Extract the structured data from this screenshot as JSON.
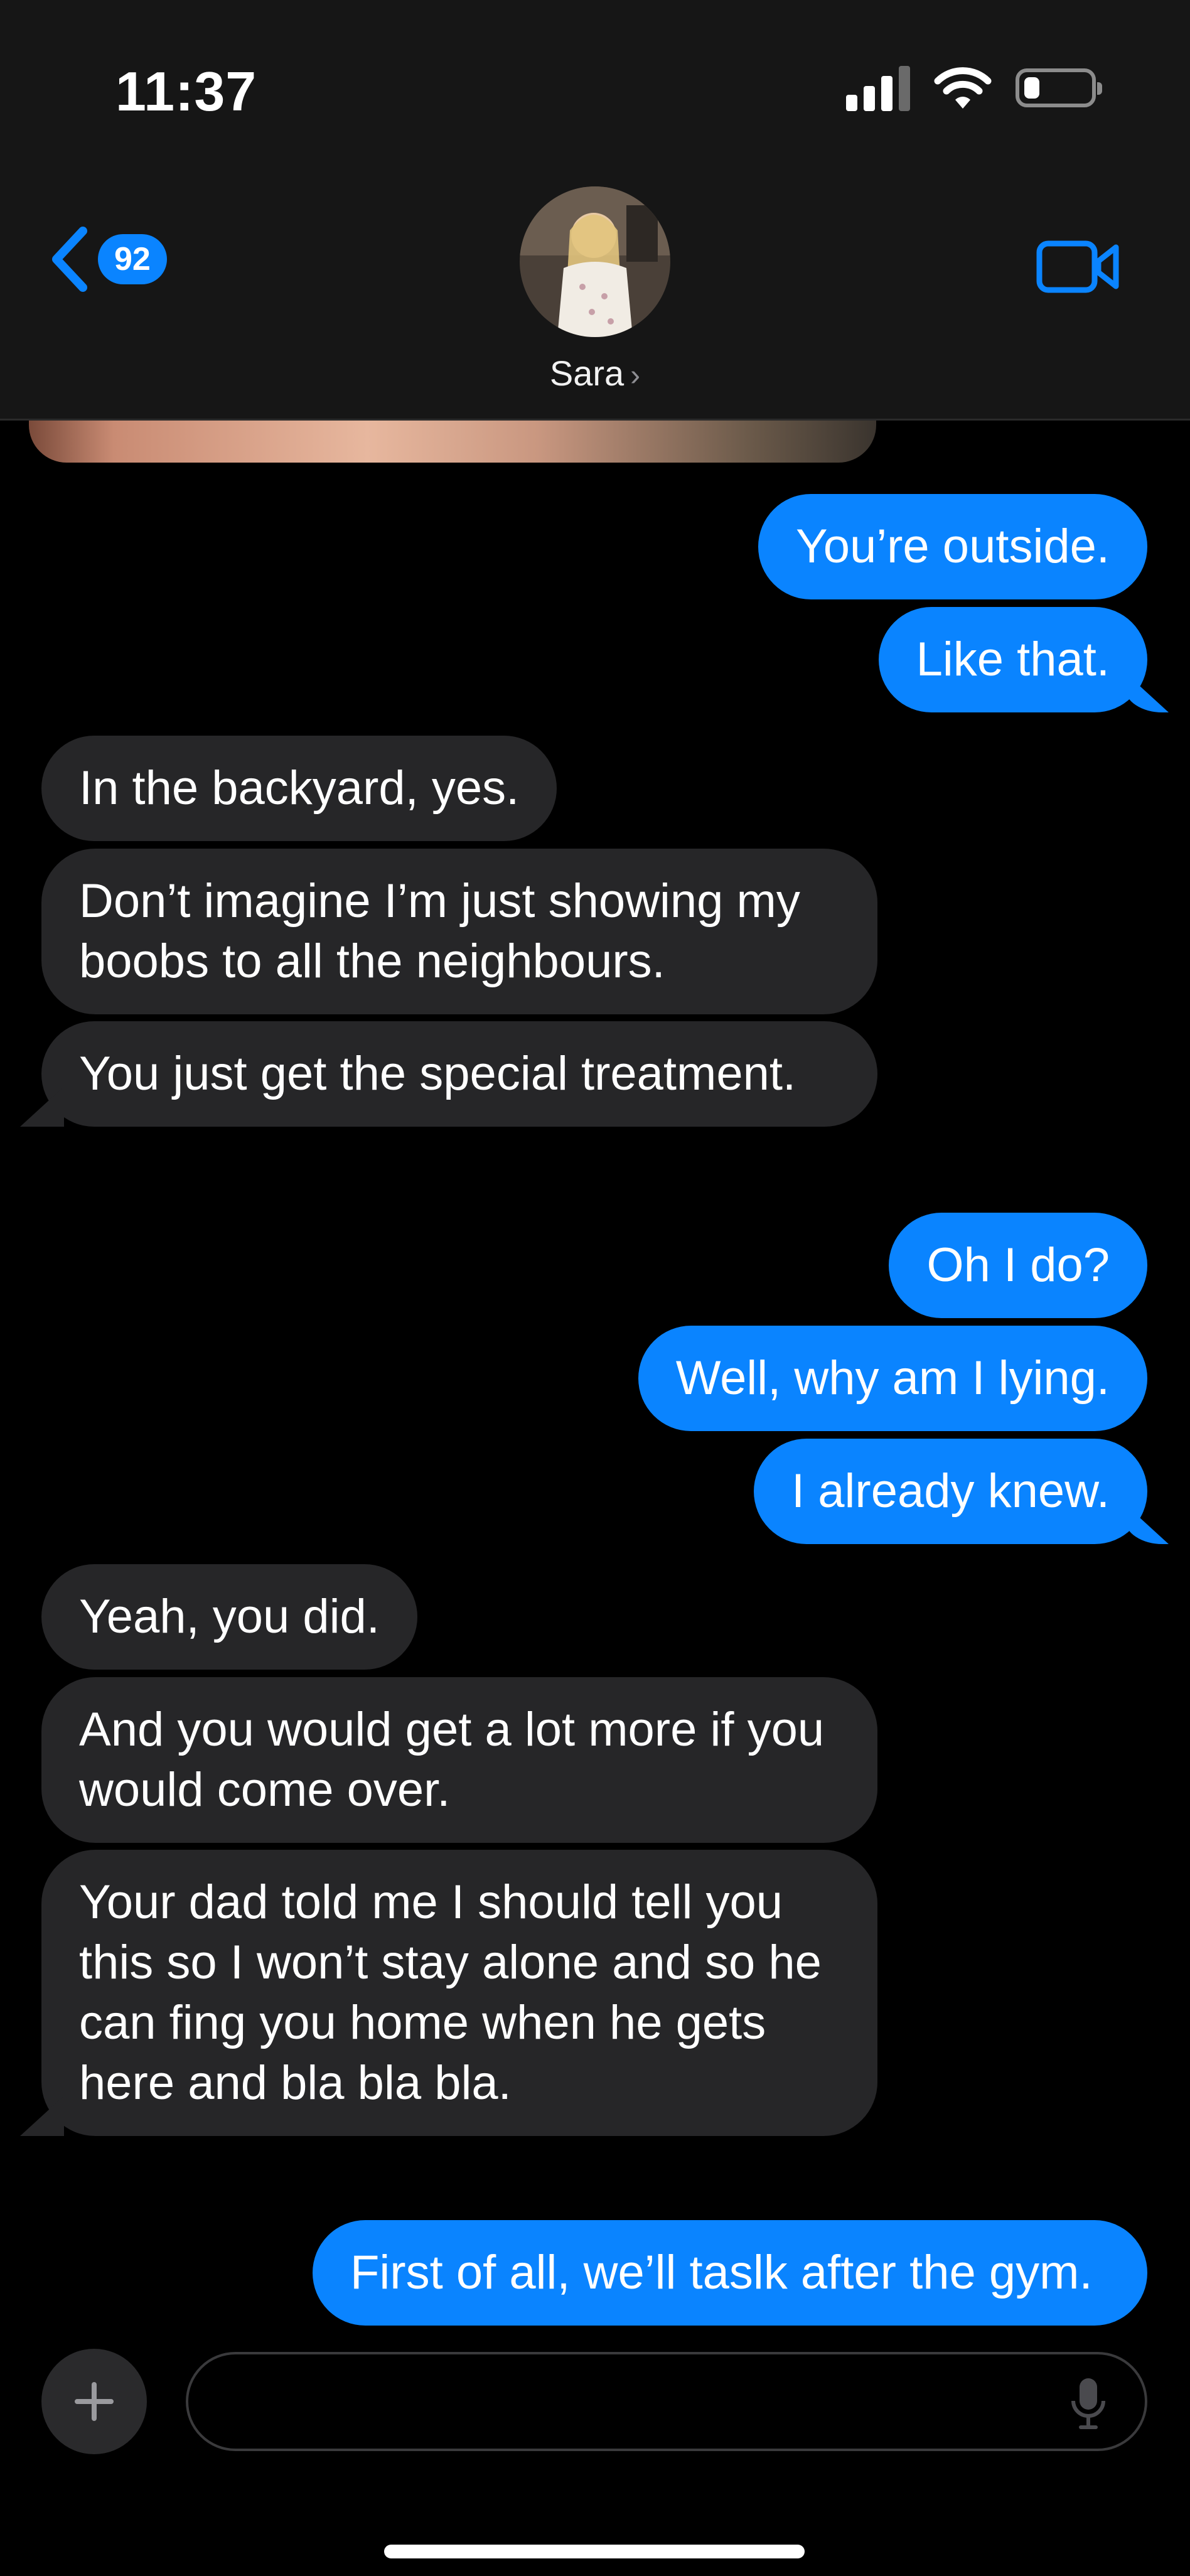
{
  "status_bar": {
    "time": "11:37"
  },
  "header": {
    "back_badge": "92",
    "contact_name": "Sara"
  },
  "messages": [
    {
      "from": "me",
      "text": "You’re outside."
    },
    {
      "from": "me",
      "text": "Like that."
    },
    {
      "from": "them",
      "text": "In the backyard, yes."
    },
    {
      "from": "them",
      "text": "Don’t imagine I’m just showing my boobs to all the neighbours."
    },
    {
      "from": "them",
      "text": "You just get the special treatment."
    },
    {
      "from": "me",
      "text": "Oh I do?"
    },
    {
      "from": "me",
      "text": "Well, why am I lying."
    },
    {
      "from": "me",
      "text": "I already knew."
    },
    {
      "from": "them",
      "text": "Yeah, you did."
    },
    {
      "from": "them",
      "text": "And you would get a lot more if you would come over."
    },
    {
      "from": "them",
      "text": "Your dad told me I should tell you this so I won’t stay alone and so he can fing you home when he gets here and bla bla bla."
    },
    {
      "from": "me",
      "text": "First of all, we’ll taslk after the gym."
    }
  ],
  "input": {
    "placeholder": ""
  },
  "colors": {
    "outgoing": "#0a84ff",
    "incoming": "#262628",
    "background": "#000000"
  }
}
